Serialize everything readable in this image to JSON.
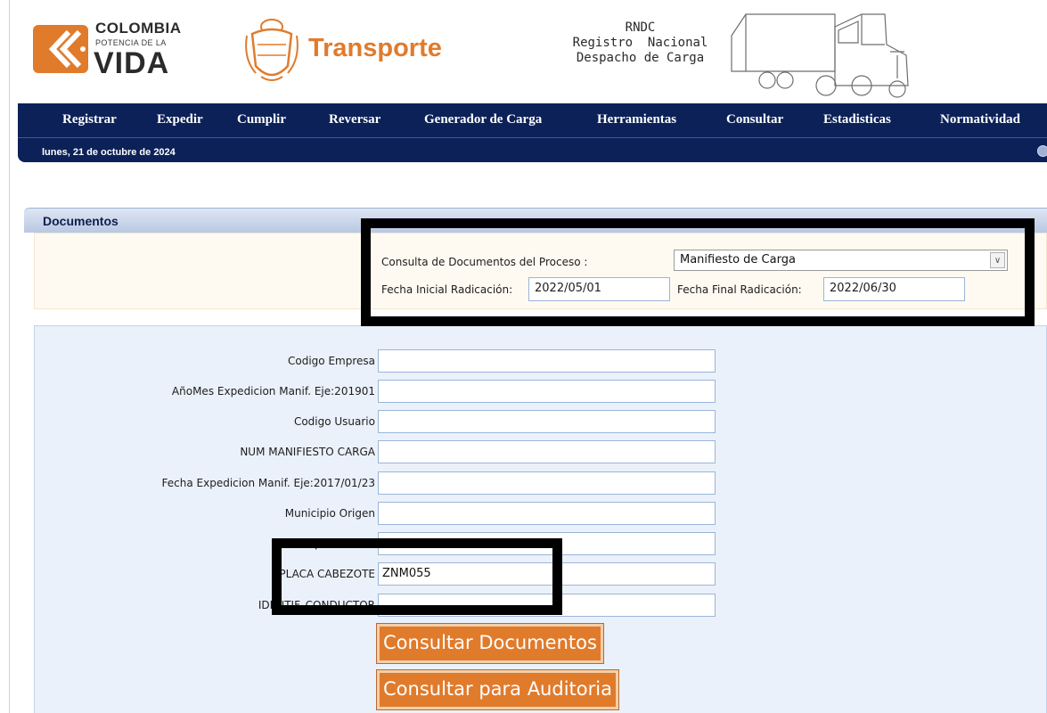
{
  "header": {
    "brand_line1": "COLOMBIA",
    "brand_line2": "POTENCIA DE LA",
    "brand_line3": "VIDA",
    "ministry": "Transporte",
    "rndc_line1": "RNDC",
    "rndc_line2": "Registro  Nacional",
    "rndc_line3": "Despacho de Carga"
  },
  "nav": {
    "items": [
      "Registrar",
      "Expedir",
      "Cumplir",
      "Reversar",
      "Generador de Carga",
      "Herramientas",
      "Consultar",
      "Estadisticas",
      "Normatividad"
    ],
    "date": "lunes, 21 de octubre de 2024"
  },
  "panel": {
    "title": "Documentos",
    "proceso_label": "Consulta de Documentos del Proceso :",
    "proceso_value": "Manifiesto de Carga",
    "fecha_inicial_label": "Fecha Inicial Radicación:",
    "fecha_inicial_value": "2022/05/01",
    "fecha_final_label": "Fecha Final Radicación:",
    "fecha_final_value": "2022/06/30"
  },
  "form": {
    "fields": [
      {
        "label": "Codigo Empresa",
        "value": ""
      },
      {
        "label": "AñoMes Expedicion Manif. Eje:201901",
        "value": ""
      },
      {
        "label": "Codigo Usuario",
        "value": ""
      },
      {
        "label": "NUM MANIFIESTO CARGA",
        "value": ""
      },
      {
        "label": "Fecha Expedicion Manif. Eje:2017/01/23",
        "value": ""
      },
      {
        "label": "Municipio Origen",
        "value": ""
      },
      {
        "label": "Municipio Destino",
        "value": ""
      },
      {
        "label": "PLACA CABEZOTE",
        "value": "ZNM055"
      },
      {
        "label": "IDENTIF. CONDUCTOR",
        "value": ""
      }
    ],
    "btn_documentos": "Consultar Documentos",
    "btn_auditoria": "Consultar para Auditoria"
  },
  "colors": {
    "nav_bg": "#0b2158",
    "accent_orange": "#e07b2c",
    "highlight": "#000000"
  }
}
